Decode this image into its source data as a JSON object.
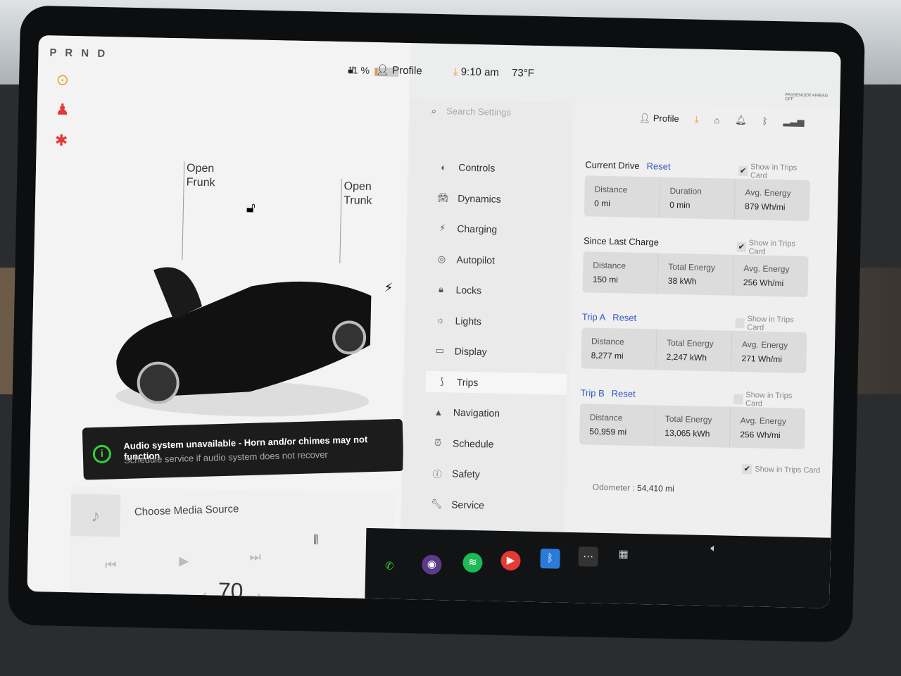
{
  "status": {
    "gear": "P R N D",
    "battery": "11 %",
    "battery_level_pct": 11,
    "profile": "Profile",
    "time": "9:10 am",
    "temp": "73°F",
    "airbag": "PASSENGER AIRBAG OFF"
  },
  "car": {
    "frunk": "Open\nFrunk",
    "trunk": "Open\nTrunk"
  },
  "alert": {
    "title": "Audio system unavailable - Horn and/or chimes may not function",
    "subtitle": "Schedule service if audio system does not recover"
  },
  "media": {
    "source": "Choose Media Source"
  },
  "speed": "70",
  "settings": {
    "search_placeholder": "Search Settings",
    "header_profile": "Profile",
    "nav": [
      {
        "label": "Controls",
        "icon": "toggle-icon"
      },
      {
        "label": "Dynamics",
        "icon": "car-icon"
      },
      {
        "label": "Charging",
        "icon": "bolt-icon"
      },
      {
        "label": "Autopilot",
        "icon": "steering-wheel-icon"
      },
      {
        "label": "Locks",
        "icon": "lock-icon"
      },
      {
        "label": "Lights",
        "icon": "light-icon"
      },
      {
        "label": "Display",
        "icon": "display-icon"
      },
      {
        "label": "Trips",
        "icon": "trips-icon",
        "active": true
      },
      {
        "label": "Navigation",
        "icon": "navigation-icon"
      },
      {
        "label": "Schedule",
        "icon": "alarm-icon"
      },
      {
        "label": "Safety",
        "icon": "safety-icon"
      },
      {
        "label": "Service",
        "icon": "wrench-icon"
      }
    ],
    "show_label": "Show in Trips Card",
    "reset": "Reset",
    "sections": [
      {
        "title": "Current Drive",
        "reset": true,
        "show": true,
        "cells": [
          {
            "k": "Distance",
            "v": "0 mi"
          },
          {
            "k": "Duration",
            "v": "0 min"
          },
          {
            "k": "Avg. Energy",
            "v": "879 Wh/mi"
          }
        ]
      },
      {
        "title": "Since Last Charge",
        "reset": false,
        "show": true,
        "cells": [
          {
            "k": "Distance",
            "v": "150 mi"
          },
          {
            "k": "Total Energy",
            "v": "38 kWh"
          },
          {
            "k": "Avg. Energy",
            "v": "256 Wh/mi"
          }
        ]
      },
      {
        "title": "Trip A",
        "reset": true,
        "show": false,
        "cells": [
          {
            "k": "Distance",
            "v": "8,277 mi"
          },
          {
            "k": "Total Energy",
            "v": "2,247 kWh"
          },
          {
            "k": "Avg. Energy",
            "v": "271 Wh/mi"
          }
        ]
      },
      {
        "title": "Trip B",
        "reset": true,
        "show": false,
        "cells": [
          {
            "k": "Distance",
            "v": "50,959 mi"
          },
          {
            "k": "Total Energy",
            "v": "13,065 kWh"
          },
          {
            "k": "Avg. Energy",
            "v": "256 Wh/mi"
          }
        ]
      }
    ],
    "odometer_label": "Odometer :",
    "odometer": "54,410 mi",
    "odometer_show": true
  },
  "colors": {
    "accent": "#3457c4",
    "warning": "#e53935",
    "download": "#f0a030"
  }
}
